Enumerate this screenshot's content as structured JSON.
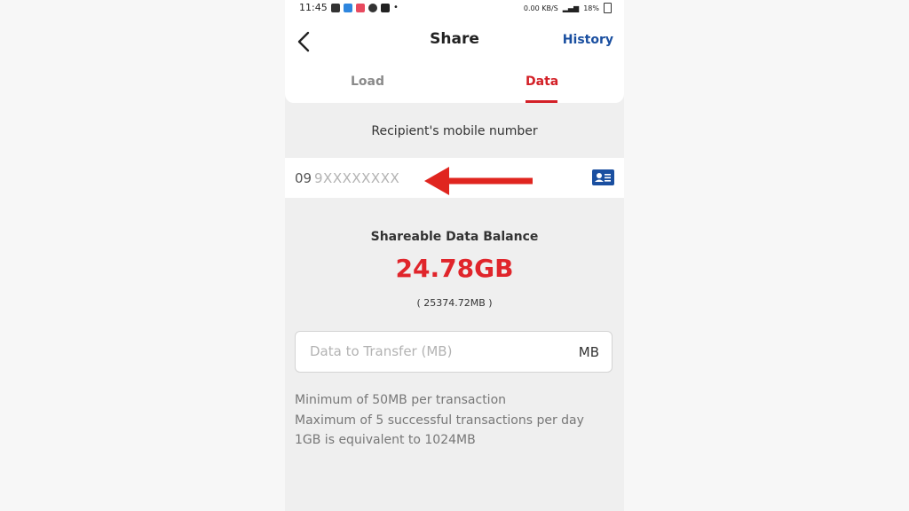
{
  "status_bar": {
    "time": "11:45",
    "right_text": "0.00 KB/S",
    "battery": "18%"
  },
  "header": {
    "title": "Share",
    "history_label": "History",
    "back_icon": "chevron-left-icon"
  },
  "tabs": [
    {
      "label": "Load",
      "active": false
    },
    {
      "label": "Data",
      "active": true
    }
  ],
  "recipient": {
    "label": "Recipient's mobile number",
    "prefix": "09",
    "placeholder": "9XXXXXXXX",
    "contact_icon": "contact-card-icon"
  },
  "balance": {
    "label": "Shareable Data Balance",
    "gb_value": "24.78GB",
    "mb_value": "( 25374.72MB )"
  },
  "transfer": {
    "placeholder": "Data to Transfer (MB)",
    "unit": "MB"
  },
  "notes": [
    "Minimum of 50MB per transaction",
    "Maximum of 5 successful transactions per day",
    "1GB is equivalent to 1024MB"
  ],
  "colors": {
    "accent_red": "#d32027",
    "link_blue": "#1a4fa0",
    "annotation_arrow": "#e0251f"
  }
}
